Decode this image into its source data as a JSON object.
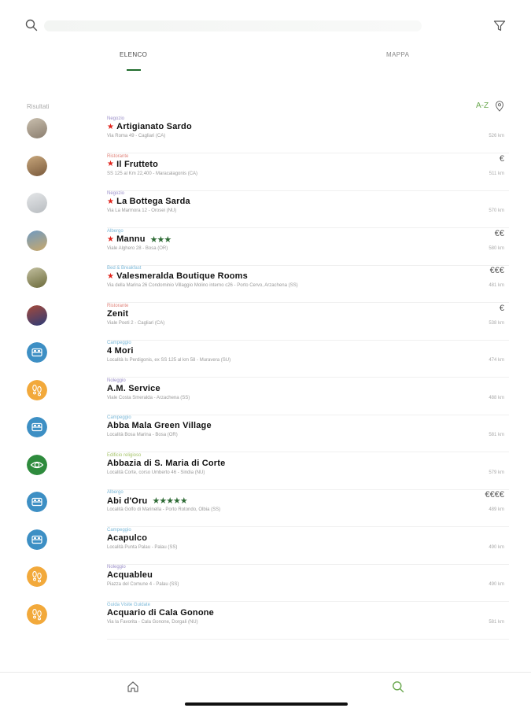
{
  "search": {
    "placeholder": ""
  },
  "tabs": [
    {
      "label": "ELENCO",
      "active": true
    },
    {
      "label": "MAPPA",
      "active": false
    }
  ],
  "results": {
    "label": "Risultati",
    "sort_label": "A-Z",
    "accent_color": "#6aa84f"
  },
  "items": [
    {
      "category": "Negozio",
      "category_color": "#9b8fc9",
      "name": "Artigianato Sardo",
      "featured": true,
      "stars": "",
      "address": "Via Roma 49 - Cagliari (CA)",
      "price": "",
      "distance": "526 km",
      "thumb": "photo",
      "photo_colors": [
        "#8a7d6e",
        "#c9bfae"
      ]
    },
    {
      "category": "Ristorante",
      "category_color": "#e0837a",
      "name": "Il Frutteto",
      "featured": true,
      "stars": "",
      "address": "SS 125 al Km 22,400 - Maracalagonis (CA)",
      "price": "€",
      "distance": "511 km",
      "thumb": "photo",
      "photo_colors": [
        "#7a5a3c",
        "#c8a77c"
      ]
    },
    {
      "category": "Negozio",
      "category_color": "#9b8fc9",
      "name": "La Bottega Sarda",
      "featured": true,
      "stars": "",
      "address": "Via La Marmora 12 - Orosei (NU)",
      "price": "",
      "distance": "570 km",
      "thumb": "photo",
      "photo_colors": [
        "#b8bcc0",
        "#e4e6e8"
      ]
    },
    {
      "category": "Albergo",
      "category_color": "#7bb8d8",
      "name": "Mannu",
      "featured": true,
      "stars": "★★★",
      "address": "Viale Alghero 28 - Bosa (OR)",
      "price": "€€",
      "distance": "580 km",
      "thumb": "photo",
      "photo_colors": [
        "#c9a86a",
        "#6f9ac2"
      ]
    },
    {
      "category": "Bed & Breakfast",
      "category_color": "#7bb8d8",
      "name": "Valesmeralda Boutique Rooms",
      "featured": true,
      "stars": "",
      "address": "Via della Marina 26 Condominio Villaggio Molino interno c26 - Porto Cervo, Arzachena (SS)",
      "price": "€€€",
      "distance": "481 km",
      "thumb": "photo",
      "photo_colors": [
        "#6b6a3a",
        "#c3c0a0"
      ]
    },
    {
      "category": "Ristorante",
      "category_color": "#e0837a",
      "name": "Zenit",
      "featured": false,
      "stars": "",
      "address": "Viale Poeti 2 - Cagliari (CA)",
      "price": "€",
      "distance": "538 km",
      "thumb": "photo",
      "photo_colors": [
        "#2d3c78",
        "#a64a3a"
      ]
    },
    {
      "category": "Campeggio",
      "category_color": "#7bb8d8",
      "name": "4 Mori",
      "featured": false,
      "stars": "",
      "address": "Località Is Perdigonis, ex SS 125 al km 58 - Muravera (SU)",
      "price": "",
      "distance": "474 km",
      "thumb": "bed",
      "icon_color": "#3d8fc4"
    },
    {
      "category": "Noleggio",
      "category_color": "#9b8fc9",
      "name": "A.M. Service",
      "featured": false,
      "stars": "",
      "address": "Viale Costa Smeralda - Arzachena (SS)",
      "price": "",
      "distance": "488 km",
      "thumb": "steps",
      "icon_color": "#f2a93b"
    },
    {
      "category": "Campeggio",
      "category_color": "#7bb8d8",
      "name": "Abba Mala Green Village",
      "featured": false,
      "stars": "",
      "address": "Località Bosa Marina - Bosa (OR)",
      "price": "",
      "distance": "581 km",
      "thumb": "bed",
      "icon_color": "#3d8fc4"
    },
    {
      "category": "Edificio religioso",
      "category_color": "#a6c46a",
      "name": "Abbazia di S. Maria di Corte",
      "featured": false,
      "stars": "",
      "address": "Località Corte, corso Umberto 46 - Sindia (NU)",
      "price": "",
      "distance": "579 km",
      "thumb": "eye",
      "icon_color": "#2e8b3d"
    },
    {
      "category": "Albergo",
      "category_color": "#7bb8d8",
      "name": "Abi d'Oru",
      "featured": false,
      "stars": "★★★★★",
      "address": "Località Golfo di Marinella - Porto Rotondo, Olbia (SS)",
      "price": "€€€€",
      "distance": "489 km",
      "thumb": "bed",
      "icon_color": "#3d8fc4"
    },
    {
      "category": "Campeggio",
      "category_color": "#7bb8d8",
      "name": "Acapulco",
      "featured": false,
      "stars": "",
      "address": "Località Punta Palau - Palau (SS)",
      "price": "",
      "distance": "490 km",
      "thumb": "bed",
      "icon_color": "#3d8fc4"
    },
    {
      "category": "Noleggio",
      "category_color": "#9b8fc9",
      "name": "Acquableu",
      "featured": false,
      "stars": "",
      "address": "Piazza del Comune 4 - Palau (SS)",
      "price": "",
      "distance": "490 km",
      "thumb": "steps",
      "icon_color": "#f2a93b"
    },
    {
      "category": "Guida Visite Guidate",
      "category_color": "#7bb8d8",
      "name": "Acquario di Cala Gonone",
      "featured": false,
      "stars": "",
      "address": "Via la Favorita - Cala Gonone, Dorgali (NU)",
      "price": "",
      "distance": "581 km",
      "thumb": "steps",
      "icon_color": "#f2a93b"
    }
  ],
  "colors": {
    "star_red": "#e0241c",
    "star_green": "#2e6b35",
    "tab_indicator": "#1f6b2c",
    "search_active": "#6aa84f"
  }
}
